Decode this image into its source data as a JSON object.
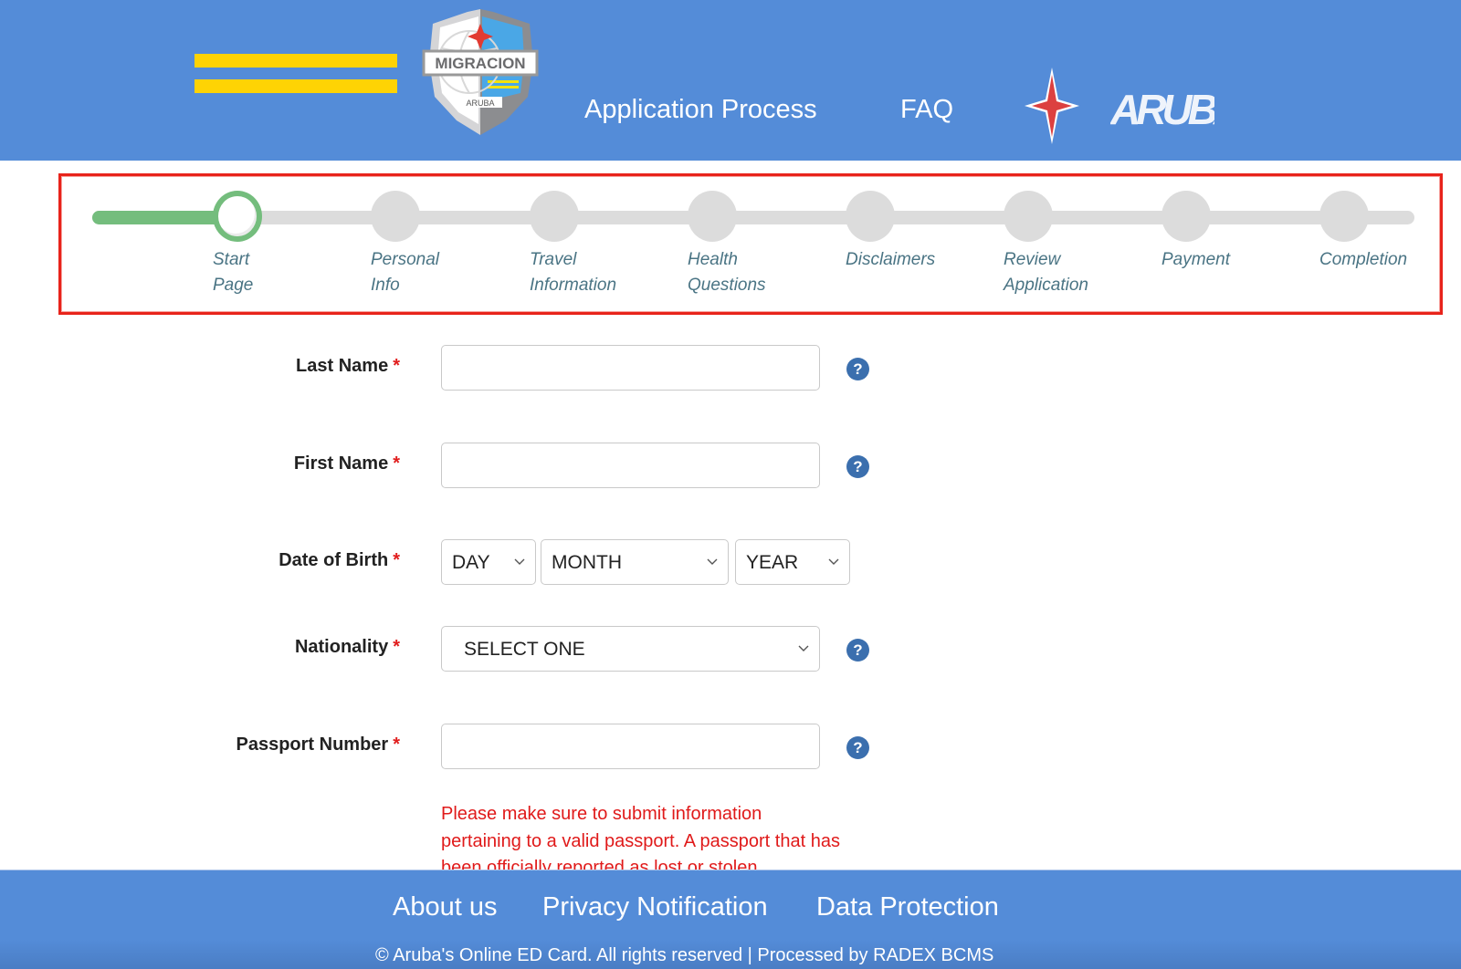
{
  "header": {
    "menu_icon": "hamburger-menu-icon",
    "logo": {
      "title": "MIGRACION",
      "subtitle": "ARUBA"
    },
    "nav": [
      {
        "label": "Application Process"
      },
      {
        "label": "FAQ"
      }
    ],
    "brand": {
      "star_icon": "red-compass-star-icon",
      "wordmark": "ARUBA"
    },
    "colors": {
      "bar": "#548cd8",
      "menu": "#fed304"
    }
  },
  "progress": {
    "current_step": 1,
    "total_steps": 8,
    "steps": [
      {
        "label": "Start\nPage",
        "state": "active"
      },
      {
        "label": "Personal\nInfo",
        "state": "pending"
      },
      {
        "label": "Travel\nInformation",
        "state": "pending"
      },
      {
        "label": "Health\nQuestions",
        "state": "pending"
      },
      {
        "label": "Disclaimers",
        "state": "pending"
      },
      {
        "label": "Review\nApplication",
        "state": "pending"
      },
      {
        "label": "Payment",
        "state": "pending"
      },
      {
        "label": "Completion",
        "state": "pending"
      }
    ],
    "colors": {
      "complete": "#74bd7d",
      "pending": "#dcdcdc",
      "highlight_border": "#e8231b"
    }
  },
  "form": {
    "required_marker": "*",
    "last_name": {
      "label": "Last Name",
      "value": "",
      "placeholder": ""
    },
    "first_name": {
      "label": "First Name",
      "value": "",
      "placeholder": ""
    },
    "dob": {
      "label": "Date of Birth",
      "day": {
        "selected": "DAY"
      },
      "month": {
        "selected": "MONTH"
      },
      "year": {
        "selected": "YEAR"
      }
    },
    "nationality": {
      "label": "Nationality",
      "selected": "SELECT ONE"
    },
    "passport_number": {
      "label": "Passport Number",
      "value": "",
      "placeholder": ""
    },
    "help_glyph": "?",
    "passport_warning": "Please make sure to submit information pertaining to a valid passport. A passport that has been officially reported as lost or stolen"
  },
  "footer": {
    "links": [
      {
        "label": "About us"
      },
      {
        "label": "Privacy Notification"
      },
      {
        "label": "Data Protection"
      }
    ],
    "copyright": "©  Aruba's Online ED Card. All rights reserved | Processed by RADEX BCMS"
  }
}
